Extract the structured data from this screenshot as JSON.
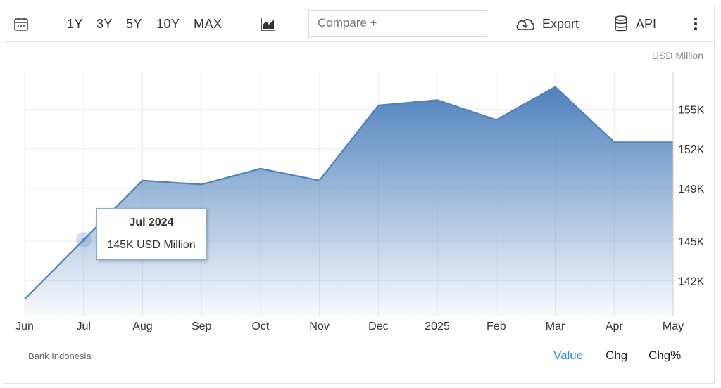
{
  "toolbar": {
    "ranges": [
      "1Y",
      "3Y",
      "5Y",
      "10Y",
      "MAX"
    ],
    "compare_placeholder": "Compare +",
    "export_label": "Export",
    "api_label": "API",
    "icons": [
      "calendar-icon",
      "area-chart-icon",
      "cloud-download-icon",
      "database-icon",
      "more-vertical-icon"
    ]
  },
  "chart_data": {
    "type": "area",
    "unit_label": "USD Million",
    "x": [
      "Jun",
      "Jul",
      "Aug",
      "Sep",
      "Oct",
      "Nov",
      "Dec",
      "2025",
      "Feb",
      "Mar",
      "Apr",
      "May"
    ],
    "values": [
      140.6,
      145.1,
      149.6,
      149.3,
      150.5,
      149.6,
      155.3,
      155.7,
      154.2,
      156.7,
      152.5,
      152.5
    ],
    "y_ticks": [
      142,
      145,
      149,
      152,
      155
    ],
    "y_tick_labels": [
      "142K",
      "145K",
      "149K",
      "152K",
      "155K"
    ],
    "ylim": [
      139.3,
      157.8
    ],
    "color": "#4f81bd",
    "grid": true,
    "tooltip": {
      "title": "Jul 2024",
      "value": "145K USD Million",
      "index": 1
    }
  },
  "footer": {
    "source": "Bank Indonesia",
    "modes": [
      "Value",
      "Chg",
      "Chg%"
    ],
    "active_mode": "Value",
    "active_color": "#2a8fd6"
  }
}
